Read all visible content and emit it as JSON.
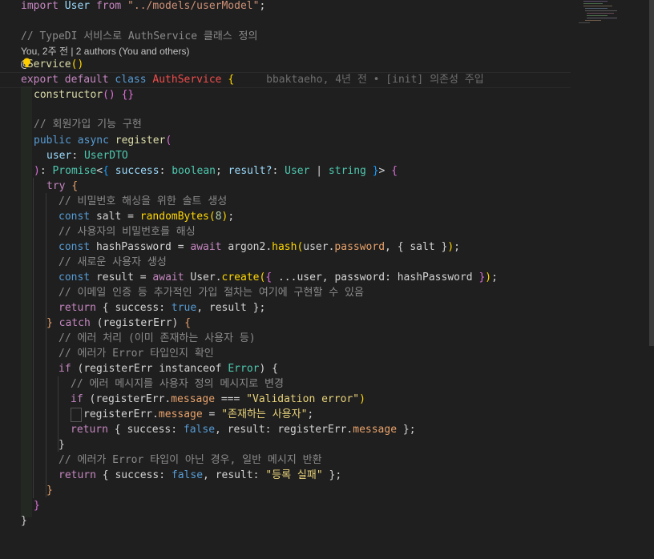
{
  "code": {
    "l0": {
      "import_kw": "import",
      "name": "User",
      "from_kw": "from",
      "path": "\"../models/userModel\"",
      "semi": ";"
    },
    "l2": {
      "comment": "// TypeDI 서비스로 AuthService 클래스 정의"
    },
    "blame": {
      "text": "You, 2주 전 | 2 authors (You and others)"
    },
    "l3": {
      "at": "@",
      "decorator": "Service",
      "paren": "()"
    },
    "l4": {
      "export_kw": "export",
      "default_kw": "default",
      "class_kw": "class",
      "class_name": "AuthService",
      "brace": "{",
      "inline_blame": "bbaktaeho, 4년 전 • [init] 의존성 주입"
    },
    "l5": {
      "ctor": "constructor",
      "parens": "()",
      "body": "{}"
    },
    "l7": {
      "comment": "// 회원가입 기능 구현"
    },
    "l8": {
      "public_kw": "public",
      "async_kw": "async",
      "fn": "register",
      "paren": "("
    },
    "l9": {
      "param": "user",
      "colon": ":",
      "type": "UserDTO"
    },
    "l10": {
      "close": ")",
      "colon": ":",
      "promise": "Promise",
      "lt": "<",
      "ob": "{",
      "success": "success",
      "bool": "boolean",
      "semi": ";",
      "result": "result?",
      "colon2": ":",
      "user": "User",
      "pipe": "|",
      "string": "string",
      "cb": "}",
      "gt": ">",
      "brace": "{"
    },
    "l11": {
      "try_kw": "try",
      "brace": "{"
    },
    "l12": {
      "comment": "// 비밀번호 해싱을 위한 솔트 생성"
    },
    "l13": {
      "const_kw": "const",
      "name": "salt",
      "eq": "=",
      "fn": "randomBytes",
      "op": "(",
      "num": "8",
      "cp": ")",
      "semi": ";"
    },
    "l14": {
      "comment": "// 사용자의 비밀번호를 해싱"
    },
    "l15": {
      "const_kw": "const",
      "name": "hashPassword",
      "eq": "=",
      "await_kw": "await",
      "obj": "argon2",
      "dot": ".",
      "fn": "hash",
      "op": "(",
      "arg1": "user",
      "dot2": ".",
      "prop": "password",
      "comma": ",",
      "ob": "{",
      "salt": "salt",
      "cb": "}",
      "cp": ")",
      "semi": ";"
    },
    "l16": {
      "comment": "// 새로운 사용자 생성"
    },
    "l17": {
      "const_kw": "const",
      "name": "result",
      "eq": "=",
      "await_kw": "await",
      "obj": "User",
      "dot": ".",
      "fn": "create",
      "op": "(",
      "ob": "{",
      "spread": "...user",
      "comma": ",",
      "key": "password",
      "colon": ":",
      "val": "hashPassword",
      "cb": "}",
      "cp": ")",
      "semi": ";"
    },
    "l18": {
      "comment": "// 이메일 인증 등 추가적인 가입 절차는 여기에 구현할 수 있음"
    },
    "l19": {
      "return_kw": "return",
      "ob": "{",
      "key1": "success",
      "colon": ":",
      "val1": "true",
      "comma": ",",
      "key2": "result",
      "cb": "}",
      "semi": ";"
    },
    "l20": {
      "cb": "}",
      "catch_kw": "catch",
      "op": "(",
      "err": "registerErr",
      "cp": ")",
      "ob": "{"
    },
    "l21": {
      "comment": "// 에러 처리 (이미 존재하는 사용자 등)"
    },
    "l22": {
      "comment": "// 에러가 Error 타입인지 확인"
    },
    "l23": {
      "if_kw": "if",
      "op": "(",
      "err": "registerErr",
      "instanceof_kw": "instanceof",
      "type": "Error",
      "cp": ")",
      "ob": "{"
    },
    "l24": {
      "comment": "// 에러 메시지를 사용자 정의 메시지로 변경"
    },
    "l25": {
      "if_kw": "if",
      "op": "(",
      "err": "registerErr",
      "dot": ".",
      "prop": "message",
      "eq": "===",
      "str": "\"Validation error\"",
      "cp": ")"
    },
    "l26": {
      "err": "registerErr",
      "dot": ".",
      "prop": "message",
      "eq": "=",
      "str": "\"존재하는 사용자\"",
      "semi": ";"
    },
    "l27": {
      "return_kw": "return",
      "ob": "{",
      "key1": "success",
      "colon": ":",
      "val1": "false",
      "comma": ",",
      "key2": "result",
      "colon2": ":",
      "err": "registerErr",
      "dot": ".",
      "prop": "message",
      "cb": "}",
      "semi": ";"
    },
    "l28": {
      "cb": "}"
    },
    "l29": {
      "comment": "// 에러가 Error 타입이 아닌 경우, 일반 메시지 반환"
    },
    "l30": {
      "return_kw": "return",
      "ob": "{",
      "key1": "success",
      "colon": ":",
      "val1": "false",
      "comma": ",",
      "key2": "result",
      "colon2": ":",
      "str": "\"등록 실패\"",
      "cb": "}",
      "semi": ";"
    },
    "l31": {
      "cb": "}"
    },
    "l32": {
      "cb": "}"
    },
    "l33": {
      "cb": "}"
    }
  },
  "colors": {
    "background": "#1f1f1f",
    "keyword": "#c586c0",
    "storage": "#569cd6",
    "string": "#ce9178",
    "comment": "#6a9955",
    "function": "#dcdcaa",
    "class": "#4ec9b0",
    "variable": "#9cdcfe"
  },
  "icons": {
    "lightbulb": "lightbulb-icon"
  }
}
